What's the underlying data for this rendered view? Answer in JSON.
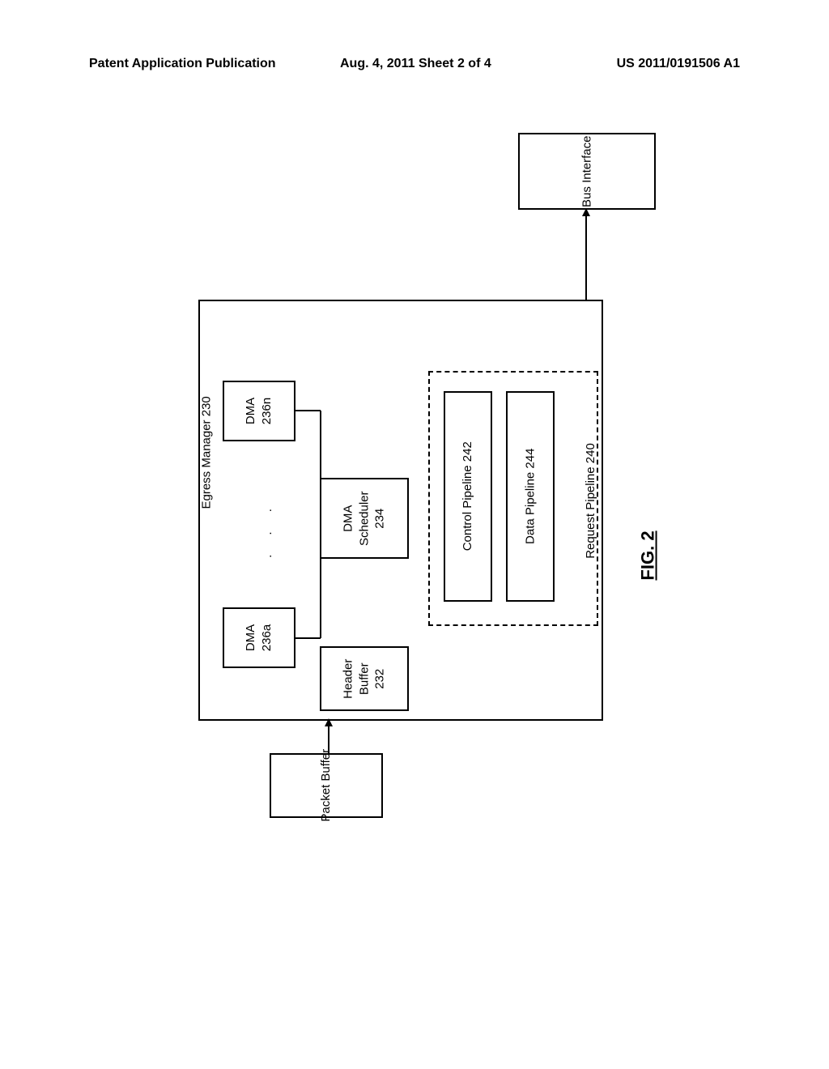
{
  "header": {
    "left": "Patent Application Publication",
    "center": "Aug. 4, 2011  Sheet 2 of 4",
    "right": "US 2011/0191506 A1"
  },
  "diagram": {
    "egress_manager": "Egress Manager 230",
    "packet_buffer": "Packet Buffer",
    "bus_interface": "Bus Interface",
    "dma_a": "DMA\n236a",
    "dma_n": "DMA\n236n",
    "dma_scheduler": "DMA\nScheduler\n234",
    "header_buffer": "Header\nBuffer\n232",
    "control_pipeline": "Control Pipeline 242",
    "data_pipeline": "Data Pipeline 244",
    "request_pipeline": "Request Pipeline 240",
    "dots": ". . .",
    "figure_label": "FIG. 2"
  }
}
